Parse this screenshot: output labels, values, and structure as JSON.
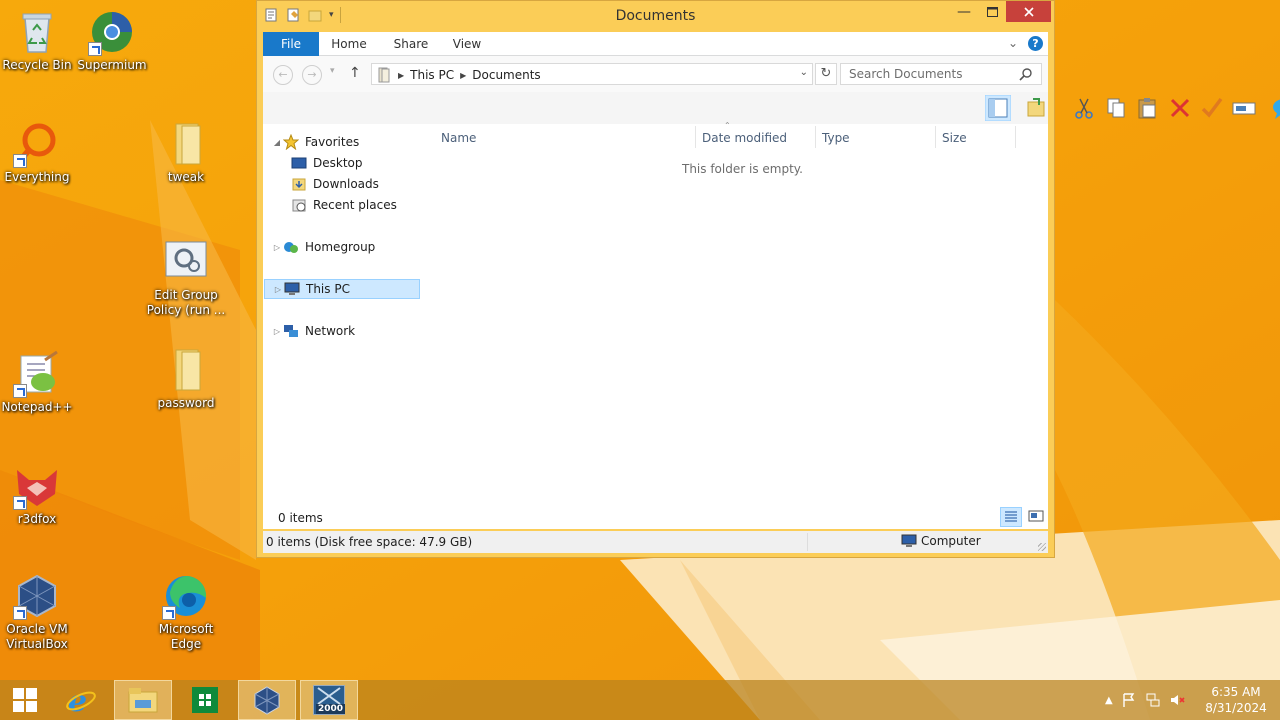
{
  "desktop": {
    "icons": [
      {
        "id": "recycle-bin",
        "label": "Recycle Bin"
      },
      {
        "id": "supermium",
        "label": "Supermium"
      },
      {
        "id": "everything",
        "label": "Everything"
      },
      {
        "id": "tweak",
        "label": "tweak"
      },
      {
        "id": "edit-group-policy",
        "label": "Edit Group Policy (run ..."
      },
      {
        "id": "notepad-plus-plus",
        "label": "Notepad++"
      },
      {
        "id": "password",
        "label": "password"
      },
      {
        "id": "r3dfox",
        "label": "r3dfox"
      },
      {
        "id": "oracle-vm-virtualbox",
        "label": "Oracle VM VirtualBox"
      },
      {
        "id": "microsoft-edge",
        "label": "Microsoft Edge"
      }
    ]
  },
  "window": {
    "title": "Documents",
    "ribbon_tabs": {
      "file": "File",
      "home": "Home",
      "share": "Share",
      "view": "View"
    },
    "address": {
      "crumb1": "This PC",
      "crumb2": "Documents"
    },
    "search": {
      "placeholder": "Search Documents"
    },
    "nav": {
      "favorites": "Favorites",
      "desktop": "Desktop",
      "downloads": "Downloads",
      "recent": "Recent places",
      "homegroup": "Homegroup",
      "thispc": "This PC",
      "network": "Network"
    },
    "columns": {
      "name": "Name",
      "date": "Date modified",
      "type": "Type",
      "size": "Size"
    },
    "empty_message": "This folder is empty.",
    "item_count": "0 items",
    "status": {
      "left": "0 items (Disk free space: 47.9 GB)",
      "right": "Computer"
    }
  },
  "taskbar": {
    "clock": {
      "time": "6:35 AM",
      "date": "8/31/2024"
    },
    "vm_badge": "2000"
  },
  "colors": {
    "accent": "#1979ca",
    "selection": "#cde8ff",
    "close": "#c7413b"
  }
}
